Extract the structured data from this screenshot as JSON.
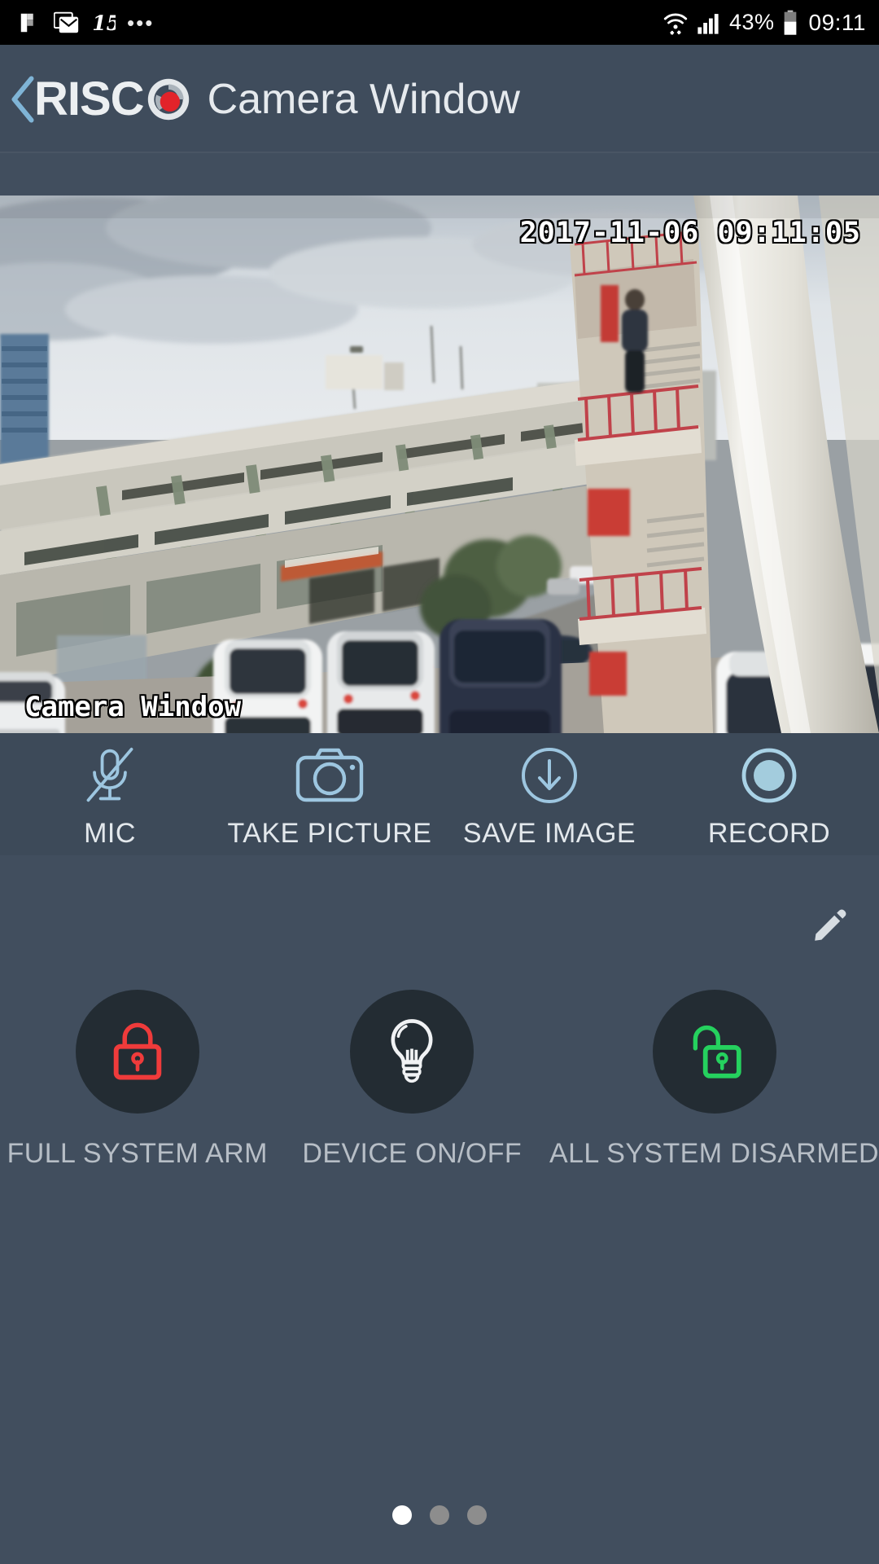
{
  "status_bar": {
    "icons_left": [
      "flipboard-icon",
      "email-icon",
      "fifteen-icon",
      "more-dots-icon"
    ],
    "more_dots": "•••",
    "wifi_icon": "wifi-icon",
    "signal_icon": "cell-signal-icon",
    "battery_percent": "43%",
    "battery_icon": "battery-icon",
    "time": "09:11"
  },
  "header": {
    "back_icon": "back-chevron-icon",
    "brand": "RISC",
    "brand_mark": "risco-aperture-logo",
    "title": "Camera Window"
  },
  "camera": {
    "timestamp": "2017-11-06 09:11:05",
    "label": "Camera Window",
    "scene": "parking-lot-cctv-feed"
  },
  "controls": [
    {
      "id": "mic",
      "label": "MIC",
      "icon": "mic-muted-icon"
    },
    {
      "id": "take-picture",
      "label": "TAKE PICTURE",
      "icon": "camera-icon"
    },
    {
      "id": "save-image",
      "label": "SAVE IMAGE",
      "icon": "download-circle-icon"
    },
    {
      "id": "record",
      "label": "RECORD",
      "icon": "record-circle-icon"
    }
  ],
  "edit": {
    "icon": "pencil-icon",
    "label": "Edit"
  },
  "actions": [
    {
      "id": "full-system-arm",
      "label": "FULL SYSTEM ARM",
      "icon": "lock-closed-icon",
      "color": "#ef3b3b"
    },
    {
      "id": "device-on-off",
      "label": "DEVICE ON/OFF",
      "icon": "lightbulb-icon",
      "color": "#f0f2f4"
    },
    {
      "id": "all-system-disarmed",
      "label": "ALL SYSTEM DISARMED",
      "icon": "lock-open-icon",
      "color": "#25d15e"
    }
  ],
  "pagination": {
    "total": 3,
    "active_index": 0
  },
  "colors": {
    "background": "#414e5e",
    "header": "#3f4c5c",
    "control_bar": "#3d4a59",
    "accent_icon": "#9dc6e0",
    "circle_bg": "#232c33",
    "armed_red": "#ef3b3b",
    "disarmed_green": "#25d15e",
    "label_text": "#b7bec6"
  }
}
